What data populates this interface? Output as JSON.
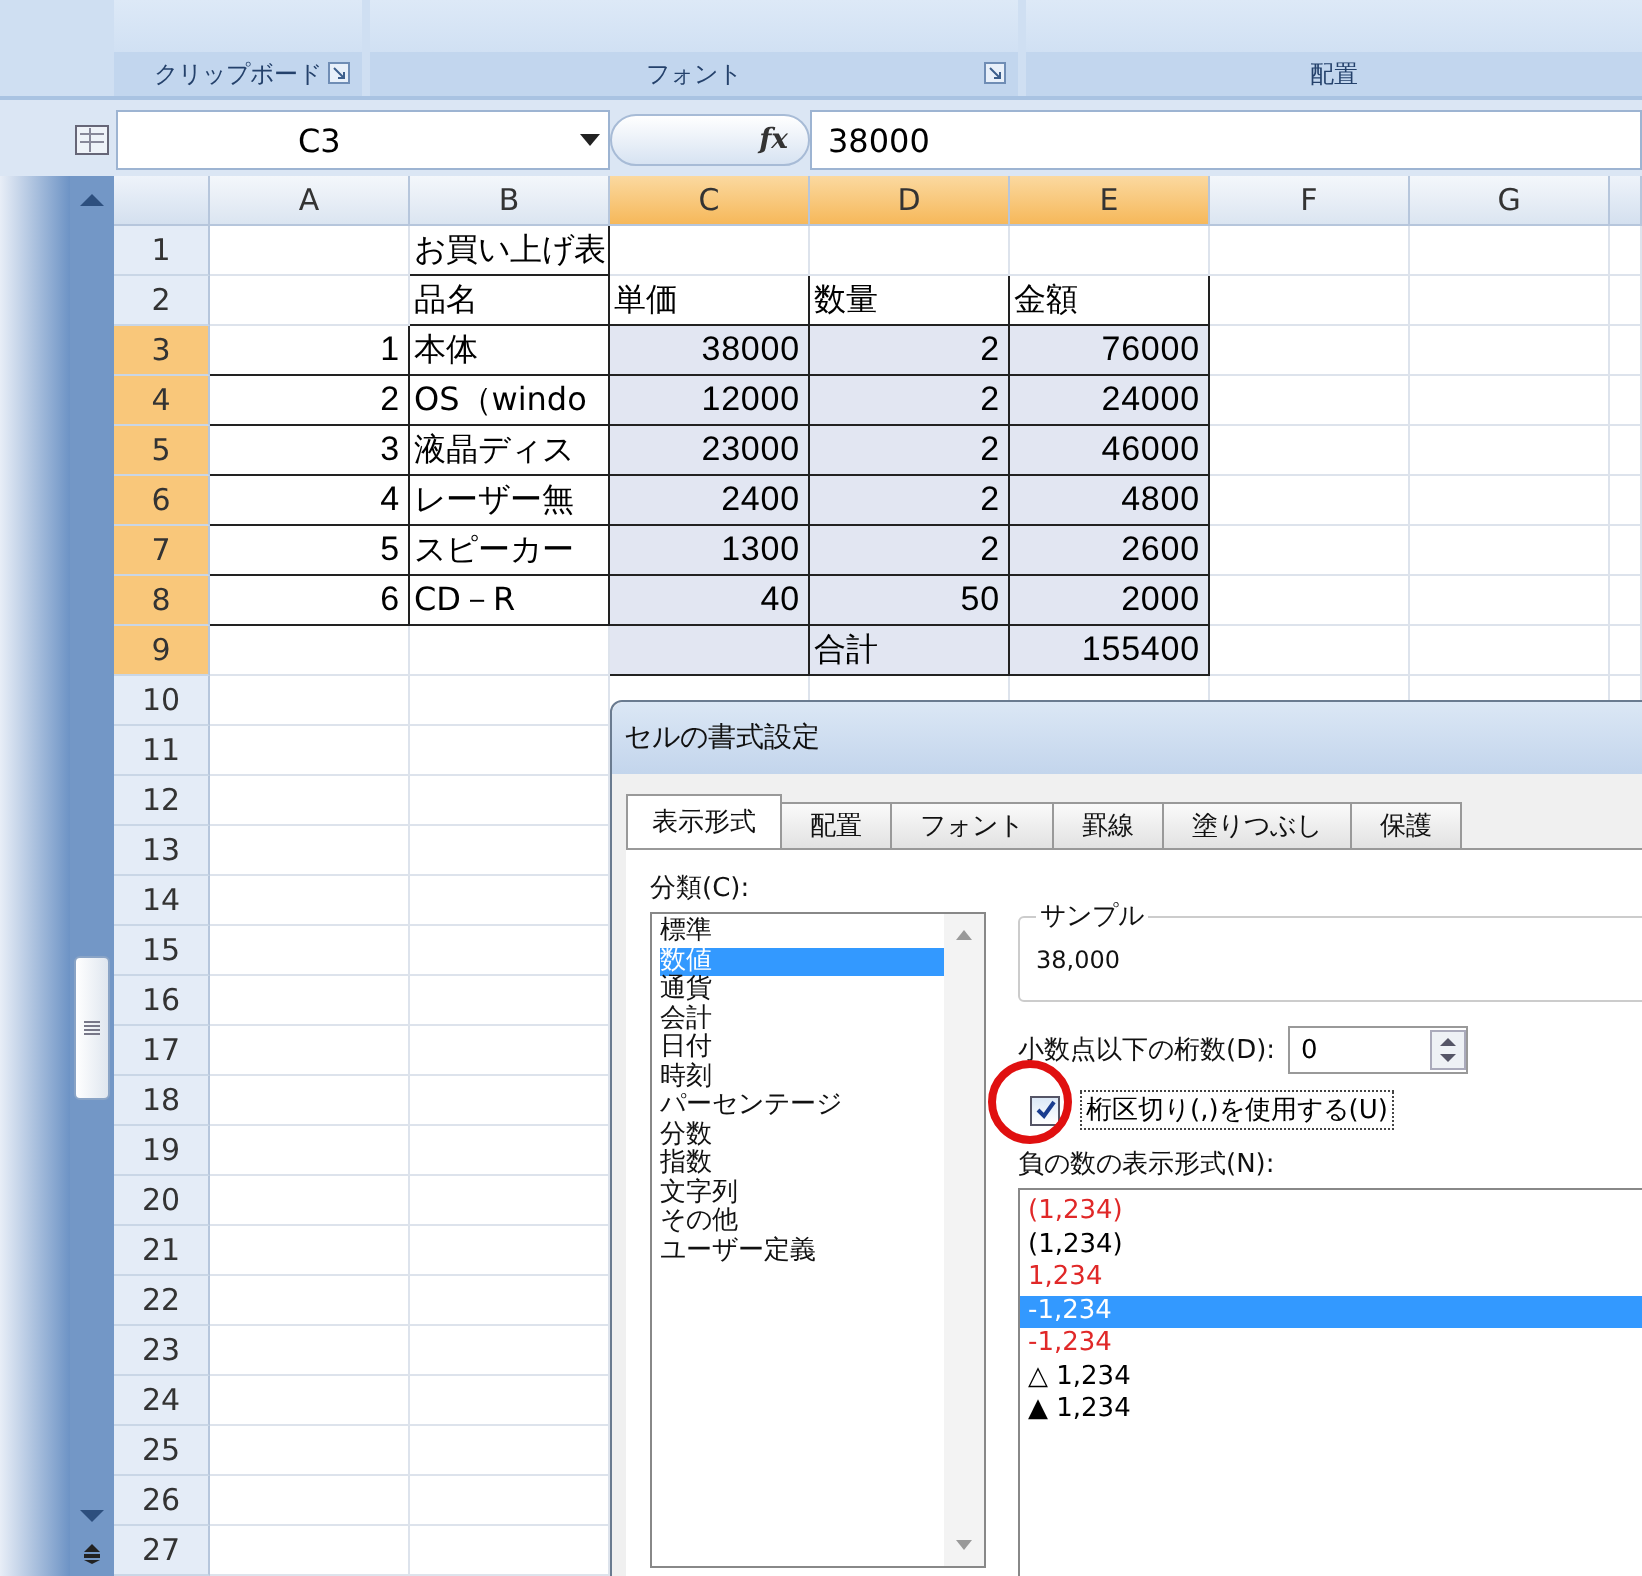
{
  "ribbon": {
    "groups": [
      {
        "label": "クリップボード",
        "launcher": true
      },
      {
        "label": "フォント",
        "launcher": true
      },
      {
        "label": "配置",
        "launcher": false
      }
    ]
  },
  "formula_bar": {
    "name_box": "C3",
    "function_label": "fx",
    "value": "38000"
  },
  "columns": [
    {
      "label": "A",
      "selected": false
    },
    {
      "label": "B",
      "selected": false
    },
    {
      "label": "C",
      "selected": true
    },
    {
      "label": "D",
      "selected": true
    },
    {
      "label": "E",
      "selected": true
    },
    {
      "label": "F",
      "selected": false
    },
    {
      "label": "G",
      "selected": false
    }
  ],
  "rows": [
    {
      "header": "1",
      "selected": false,
      "cells": {
        "b": {
          "text": "お買い上げ表",
          "kind": "text"
        }
      }
    },
    {
      "header": "2",
      "selected": false,
      "cells": {
        "b": {
          "text": "品名",
          "kind": "text"
        },
        "c": {
          "text": "単価",
          "kind": "text"
        },
        "d": {
          "text": "数量",
          "kind": "text"
        },
        "e": {
          "text": "金額",
          "kind": "text"
        }
      }
    },
    {
      "header": "3",
      "selected": true,
      "cells": {
        "a": {
          "text": "1",
          "kind": "number"
        },
        "b": {
          "text": "本体",
          "kind": "text"
        },
        "c": {
          "text": "38000",
          "kind": "number"
        },
        "d": {
          "text": "2",
          "kind": "number"
        },
        "e": {
          "text": "76000",
          "kind": "number"
        }
      }
    },
    {
      "header": "4",
      "selected": true,
      "cells": {
        "a": {
          "text": "2",
          "kind": "number"
        },
        "b": {
          "text": "OS（windo",
          "kind": "text"
        },
        "c": {
          "text": "12000",
          "kind": "number"
        },
        "d": {
          "text": "2",
          "kind": "number"
        },
        "e": {
          "text": "24000",
          "kind": "number"
        }
      }
    },
    {
      "header": "5",
      "selected": true,
      "cells": {
        "a": {
          "text": "3",
          "kind": "number"
        },
        "b": {
          "text": "液晶ディス",
          "kind": "text"
        },
        "c": {
          "text": "23000",
          "kind": "number"
        },
        "d": {
          "text": "2",
          "kind": "number"
        },
        "e": {
          "text": "46000",
          "kind": "number"
        }
      }
    },
    {
      "header": "6",
      "selected": true,
      "cells": {
        "a": {
          "text": "4",
          "kind": "number"
        },
        "b": {
          "text": "レーザー無",
          "kind": "text"
        },
        "c": {
          "text": "2400",
          "kind": "number"
        },
        "d": {
          "text": "2",
          "kind": "number"
        },
        "e": {
          "text": "4800",
          "kind": "number"
        }
      }
    },
    {
      "header": "7",
      "selected": true,
      "cells": {
        "a": {
          "text": "5",
          "kind": "number"
        },
        "b": {
          "text": "スピーカー",
          "kind": "text"
        },
        "c": {
          "text": "1300",
          "kind": "number"
        },
        "d": {
          "text": "2",
          "kind": "number"
        },
        "e": {
          "text": "2600",
          "kind": "number"
        }
      }
    },
    {
      "header": "8",
      "selected": true,
      "cells": {
        "a": {
          "text": "6",
          "kind": "number"
        },
        "b": {
          "text": "CD－R",
          "kind": "text"
        },
        "c": {
          "text": "40",
          "kind": "number"
        },
        "d": {
          "text": "50",
          "kind": "number"
        },
        "e": {
          "text": "2000",
          "kind": "number"
        }
      }
    },
    {
      "header": "9",
      "selected": true,
      "cells": {
        "d": {
          "text": "合計",
          "kind": "text"
        },
        "e": {
          "text": "155400",
          "kind": "number"
        }
      }
    },
    {
      "header": "10",
      "selected": false
    },
    {
      "header": "11",
      "selected": false
    },
    {
      "header": "12",
      "selected": false
    },
    {
      "header": "13",
      "selected": false
    },
    {
      "header": "14",
      "selected": false
    },
    {
      "header": "15",
      "selected": false
    },
    {
      "header": "16",
      "selected": false
    },
    {
      "header": "17",
      "selected": false
    },
    {
      "header": "18",
      "selected": false
    },
    {
      "header": "19",
      "selected": false
    },
    {
      "header": "20",
      "selected": false
    },
    {
      "header": "21",
      "selected": false
    },
    {
      "header": "22",
      "selected": false
    },
    {
      "header": "23",
      "selected": false
    },
    {
      "header": "24",
      "selected": false
    },
    {
      "header": "25",
      "selected": false
    },
    {
      "header": "26",
      "selected": false
    },
    {
      "header": "27",
      "selected": false
    }
  ],
  "dialog": {
    "title": "セルの書式設定",
    "tabs": [
      {
        "label": "表示形式",
        "selected": true
      },
      {
        "label": "配置",
        "selected": false
      },
      {
        "label": "フォント",
        "selected": false
      },
      {
        "label": "罫線",
        "selected": false
      },
      {
        "label": "塗りつぶし",
        "selected": false
      },
      {
        "label": "保護",
        "selected": false
      }
    ],
    "category_label": "分類(C):",
    "categories": [
      {
        "label": "標準",
        "selected": false
      },
      {
        "label": "数値",
        "selected": true
      },
      {
        "label": "通貨",
        "selected": false
      },
      {
        "label": "会計",
        "selected": false
      },
      {
        "label": "日付",
        "selected": false
      },
      {
        "label": "時刻",
        "selected": false
      },
      {
        "label": "パーセンテージ",
        "selected": false
      },
      {
        "label": "分数",
        "selected": false
      },
      {
        "label": "指数",
        "selected": false
      },
      {
        "label": "文字列",
        "selected": false
      },
      {
        "label": "その他",
        "selected": false
      },
      {
        "label": "ユーザー定義",
        "selected": false
      }
    ],
    "sample": {
      "label": "サンプル",
      "value": "38,000"
    },
    "decimal_places": {
      "label": "小数点以下の桁数(D):",
      "value": "0"
    },
    "separator": {
      "label": "桁区切り(,)を使用する(U)",
      "checked": true
    },
    "negative": {
      "label": "負の数の表示形式(N):",
      "formats": [
        {
          "label": "(1,234)",
          "color": "#e02828",
          "selected": false
        },
        {
          "label": "(1,234)",
          "color": "#000000",
          "selected": false
        },
        {
          "label": "1,234",
          "color": "#e02828",
          "selected": false
        },
        {
          "label": "-1,234",
          "selected": true
        },
        {
          "label": "-1,234",
          "color": "#e02828",
          "selected": false
        },
        {
          "label": "△ 1,234",
          "color": "#000000",
          "selected": false
        },
        {
          "label": "▲ 1,234",
          "color": "#000000",
          "selected": false
        }
      ]
    }
  }
}
